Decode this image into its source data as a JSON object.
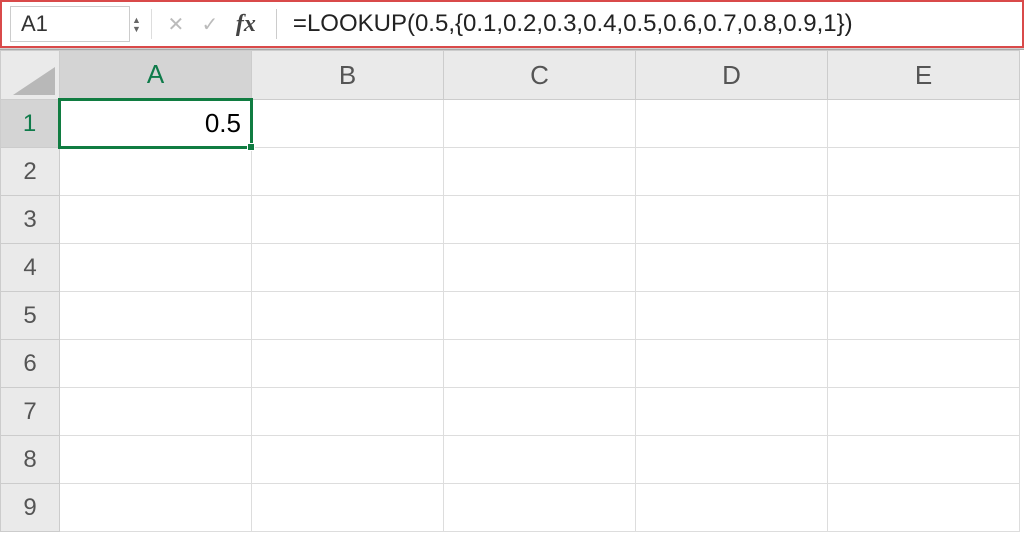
{
  "nameBox": "A1",
  "formula": "=LOOKUP(0.5,{0.1,0.2,0.3,0.4,0.5,0.6,0.7,0.8,0.9,1})",
  "fxLabel": "fx",
  "columns": [
    "A",
    "B",
    "C",
    "D",
    "E"
  ],
  "rows": [
    "1",
    "2",
    "3",
    "4",
    "5",
    "6",
    "7",
    "8",
    "9"
  ],
  "activeCellValue": "0.5",
  "activeCell": {
    "row": 0,
    "col": 0
  }
}
